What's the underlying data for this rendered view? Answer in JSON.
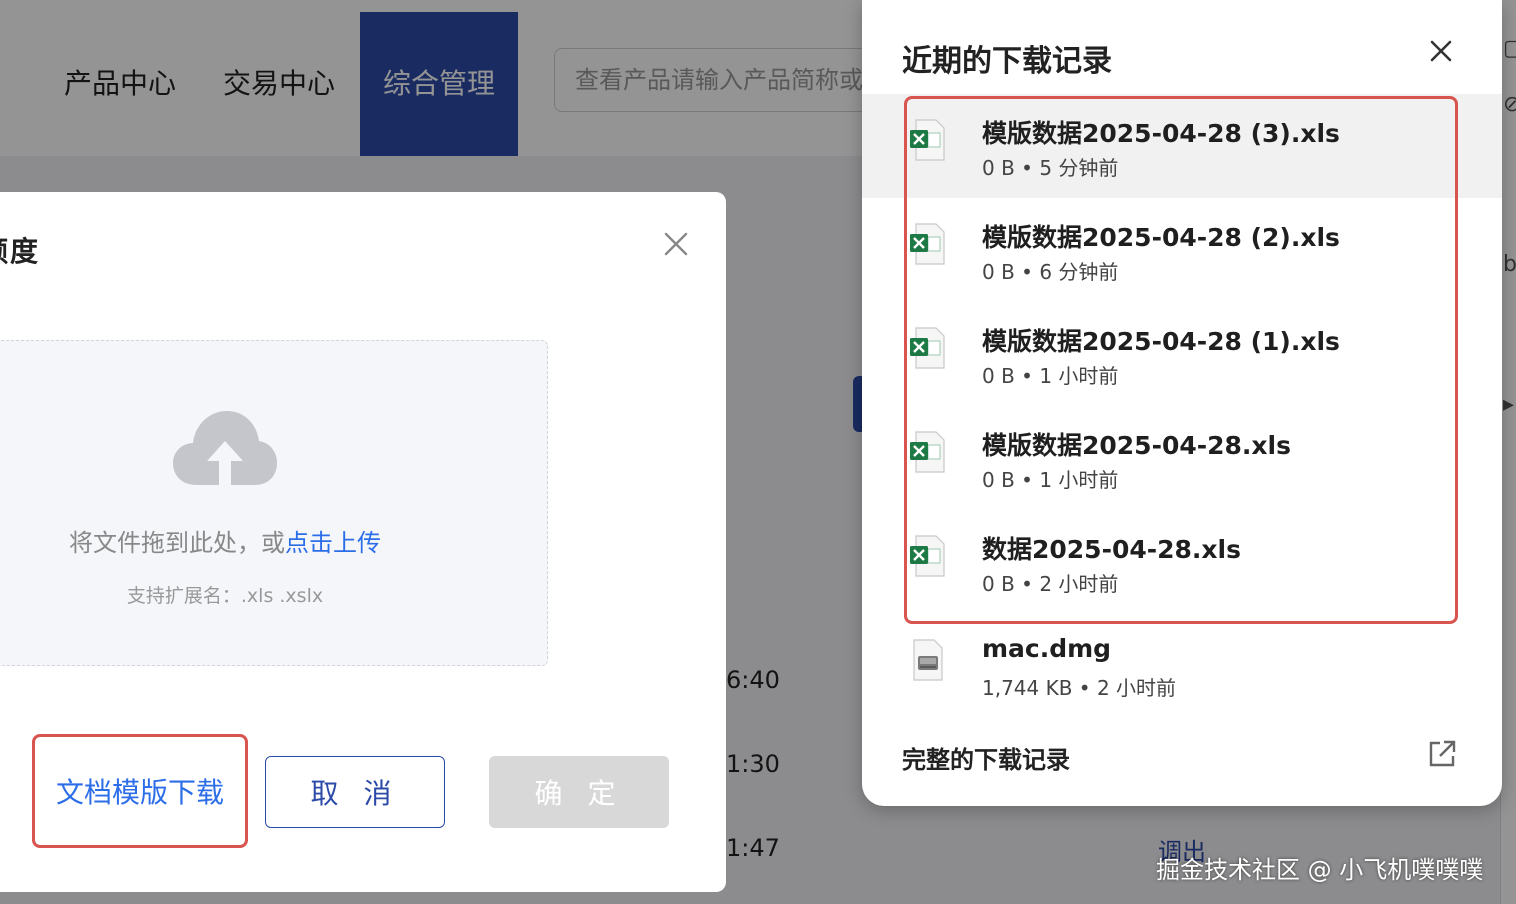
{
  "nav": {
    "items": [
      "产品中心",
      "交易中心",
      "综合管理"
    ],
    "search_placeholder": "查看产品请输入产品简称或代码"
  },
  "background": {
    "times": [
      "6:40",
      "1:30",
      "1:47"
    ],
    "export_link": "调出"
  },
  "dialog": {
    "title": "额度",
    "upload": {
      "prompt": "将文件拖到此处，或",
      "link": "点击上传",
      "hint": "支持扩展名：.xls .xslx"
    },
    "buttons": {
      "template": "文档模版下载",
      "cancel": "取 消",
      "confirm": "确 定"
    }
  },
  "downloads": {
    "title": "近期的下载记录",
    "items": [
      {
        "name": "模版数据2025-04-28 (3).xls",
        "meta": "0 B • 5 分钟前",
        "icon": "excel-file-icon"
      },
      {
        "name": "模版数据2025-04-28 (2).xls",
        "meta": "0 B • 6 分钟前",
        "icon": "excel-file-icon"
      },
      {
        "name": "模版数据2025-04-28 (1).xls",
        "meta": "0 B • 1 小时前",
        "icon": "excel-file-icon"
      },
      {
        "name": "模版数据2025-04-28.xls",
        "meta": "0 B • 1 小时前",
        "icon": "excel-file-icon"
      },
      {
        "name": "数据2025-04-28.xls",
        "meta": "0 B • 2 小时前",
        "icon": "excel-file-icon"
      },
      {
        "name": "mac.dmg",
        "meta": "1,744 KB • 2 小时前",
        "icon": "disk-image-file-icon"
      }
    ],
    "footer": "完整的下载记录"
  },
  "colors": {
    "nav_active": "#2c4aa8",
    "link": "#2c6ee8",
    "highlight": "#d9534f",
    "excel_green": "#1e7a45"
  },
  "watermark": "掘金技术社区 @ 小飞机噗噗噗"
}
